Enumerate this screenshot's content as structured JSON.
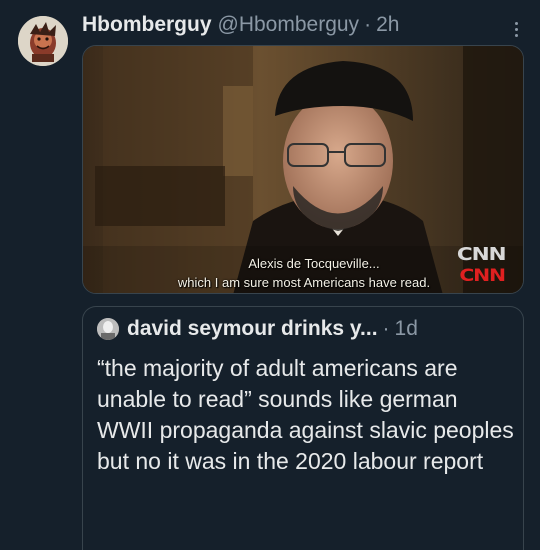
{
  "tweet": {
    "author_name": "Hbomberguy",
    "author_handle": "@Hbomberguy",
    "separator": "·",
    "time": "2h",
    "more_icon": "more-vertical-icon",
    "media": {
      "subtitle_line1": "Alexis de Tocqueville...",
      "subtitle_line2": "which I am sure most Americans have read.",
      "logo_top": "CNN",
      "logo_bottom": "CNN"
    }
  },
  "quoted_tweet": {
    "author_name": "david seymour drinks y...",
    "separator": "·",
    "time": "1d",
    "text": "“the majority of adult americans are unable to read” sounds like german WWII propaganda against slavic peoples but no it was in the 2020 labour report"
  },
  "colors": {
    "background": "#15202b",
    "primary_text": "#e7e9ea",
    "secondary_text": "#8b98a5",
    "border": "#38444d",
    "cnn_red": "#e02020"
  }
}
